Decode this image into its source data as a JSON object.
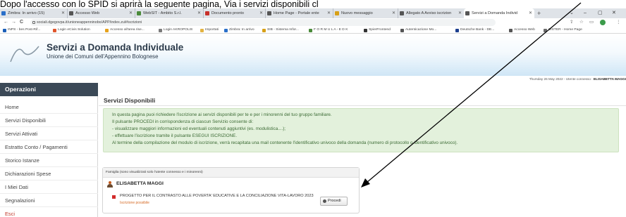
{
  "caption": "Dopo l'accesso con lo SPID si aprirà la seguente pagina, Via i servizi disponibili cl",
  "browser": {
    "tabs": [
      {
        "label": "Zimbra: In arrivo (15)"
      },
      {
        "label": "Accesso Web"
      },
      {
        "label": "WebSIT - Ambito S.r.l."
      },
      {
        "label": "Documento pronto"
      },
      {
        "label": "Home Page - Portale ente"
      },
      {
        "label": "Nuovo messaggio"
      },
      {
        "label": "Allegato A Avviso iscrizion"
      },
      {
        "label": "Servizi a Domanda Individ"
      }
    ],
    "new_tab": "+",
    "window_controls": {
      "minimize": "–",
      "maximize": "▢",
      "close": "✕"
    },
    "nav": {
      "back": "←",
      "forward": "→",
      "reload": "C"
    },
    "url": "sociali.dgegovpa.it/unioneappenninobo/APP/index.zul#iscrizioni",
    "bookmarks": [
      {
        "label": "INPS - bes Post-Rif...",
        "color": "#1c5fb8"
      },
      {
        "label": "Login eCivis Solution",
        "color": "#e0552c"
      },
      {
        "label": "Accesso all'area rise...",
        "color": "#e6a21c"
      },
      {
        "label": "Login AKROPOLIS",
        "color": "#7a7a7a"
      },
      {
        "label": "Importati",
        "color": "#e3b341"
      },
      {
        "label": "Zimbra: In arrivo",
        "color": "#2a6fc9"
      },
      {
        "label": "SIB - Sistema Infor...",
        "color": "#d7a018"
      },
      {
        "label": "F O R M U L A - E D K",
        "color": "#4a8a3a"
      },
      {
        "label": "SpierFrontend",
        "color": "#333333"
      },
      {
        "label": "Autenticazione Mo...",
        "color": "#555555"
      },
      {
        "label": "Deutsche Bank - DE...",
        "color": "#1d3f8f"
      },
      {
        "label": "Accesso Web",
        "color": "#555555"
      },
      {
        "label": "SISTER - Home Page",
        "color": "#6a6a6a"
      }
    ]
  },
  "header": {
    "title": "Servizi a Domanda Individuale",
    "subtitle": "Unione dei Comuni dell'Appennino Bolognese"
  },
  "datebar": {
    "date_text": "Thursday 26 May 2022  -  Utente connesso :",
    "user": "ELISABETTA MAGGI"
  },
  "sidebar": {
    "heading": "Operazioni",
    "items": [
      {
        "label": "Home"
      },
      {
        "label": "Servizi Disponibili"
      },
      {
        "label": "Servizi Attivati"
      },
      {
        "label": "Estratto Conto / Pagamenti"
      },
      {
        "label": "Storico Istanze"
      },
      {
        "label": "Dichiarazioni Spese"
      },
      {
        "label": "I Miei Dati"
      },
      {
        "label": "Segnalazioni"
      },
      {
        "label": "Esci"
      }
    ]
  },
  "main": {
    "title": "Servizi Disponibili",
    "info_lines": [
      "In questa pagina puoi richiedere l'iscrizione ai servizi disponibili per te e per i minorenni del tuo gruppo familiare.",
      "Il pulsante PROCEDI in corrispondenza di ciascun Servizio consente di:",
      "- visualizzare maggiori informazioni ed eventuali contenuti aggiuntivi (es. modulistica....);",
      "- effettuare l'iscrizione tramite il pulsante ESEGUI ISCRIZIONE.",
      "Al termine della compilazione del modulo di iscrizione, verrà recapitata una mail contenente l'identificativo univoco della domanda (numero di protocollo o identificativo univoco)."
    ],
    "family": {
      "heading": "Famiglia (sono visualizzati solo l'utente connesso e i minorenni)",
      "person": "ELISABETTA MAGGI",
      "service": {
        "title": "PROGETTO PER IL CONTRASTO ALLE POVERTA' EDUCATIVE E LA CONCILIAZIONE VITA-LAVORO 2023",
        "status": "Iscrizione possibile",
        "button": "Procedi"
      }
    }
  },
  "colors": {
    "sidebar_header": "#3b4957",
    "info_bg": "#e3f1dc",
    "info_text": "#3c6b35",
    "exit_text": "#c0392b",
    "marker": "#d22b2b",
    "status_text": "#d66b26"
  }
}
